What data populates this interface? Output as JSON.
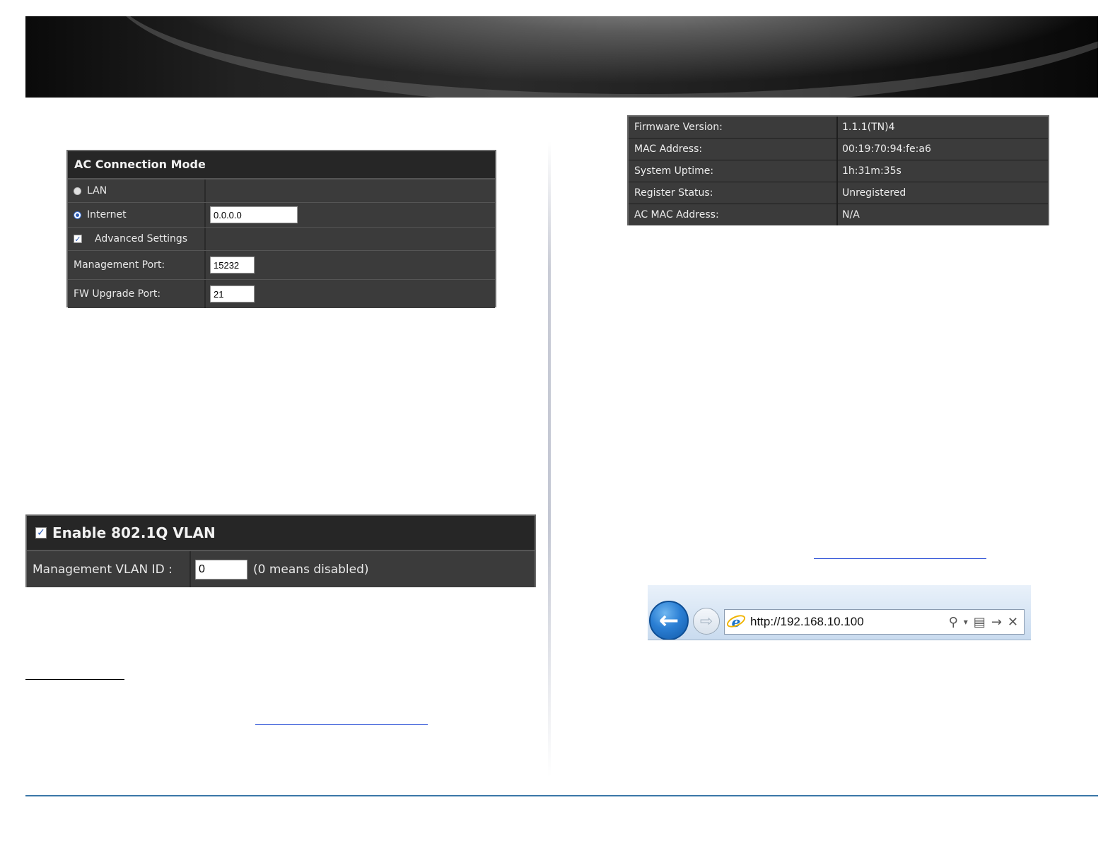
{
  "ac_panel": {
    "title": "AC Connection Mode",
    "lan_label": "LAN",
    "internet_label": "Internet",
    "internet_value": "0.0.0.0",
    "advanced_label": "Advanced Settings",
    "mgmt_port_label": "Management Port:",
    "mgmt_port_value": "15232",
    "fw_port_label": "FW Upgrade Port:",
    "fw_port_value": "21",
    "selected_mode": "Internet",
    "advanced_checked": true
  },
  "vlan_panel": {
    "title": "Enable 802.1Q VLAN",
    "enabled": true,
    "vlan_id_label": "Management VLAN ID :",
    "vlan_id_value": "0",
    "vlan_hint": "(0 means disabled)"
  },
  "info_table": {
    "rows": [
      {
        "label": "Firmware Version:",
        "value": "1.1.1(TN)4"
      },
      {
        "label": "MAC Address:",
        "value": "00:19:70:94:fe:a6"
      },
      {
        "label": "System Uptime:",
        "value": "1h:31m:35s"
      },
      {
        "label": "Register Status:",
        "value": "Unregistered"
      },
      {
        "label": "AC MAC Address:",
        "value": "N/A"
      }
    ]
  },
  "browser": {
    "url": "http://192.168.10.100",
    "back_glyph": "←",
    "forward_glyph": "⇨",
    "ie_glyph": "e",
    "search_glyph": "⚲",
    "dropdown_glyph": "▾",
    "compat_glyph": "▤",
    "go_glyph": "→",
    "stop_glyph": "✕"
  },
  "colors": {
    "panel_bg": "#3b3b3b",
    "panel_header": "#262626",
    "link_blue": "#2a4fd6",
    "footer_blue": "#3b77a8"
  }
}
